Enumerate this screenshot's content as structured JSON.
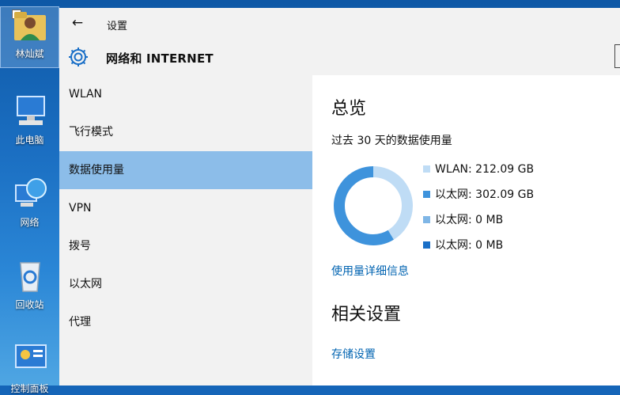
{
  "desktop": {
    "icons": [
      {
        "label": "林灿斌"
      },
      {
        "label": "此电脑"
      },
      {
        "label": "网络"
      },
      {
        "label": "回收站"
      },
      {
        "label": "控制面板"
      }
    ]
  },
  "window": {
    "title": "设置",
    "section_title": "网络和 INTERNET"
  },
  "sidebar": {
    "items": [
      {
        "label": "WLAN"
      },
      {
        "label": "飞行模式"
      },
      {
        "label": "数据使用量"
      },
      {
        "label": "VPN"
      },
      {
        "label": "拨号"
      },
      {
        "label": "以太网"
      },
      {
        "label": "代理"
      }
    ],
    "active_index": 2
  },
  "main": {
    "overview_title": "总览",
    "usage_caption": "过去 30 天的数据使用量",
    "details_link": "使用量详细信息",
    "related_title": "相关设置",
    "storage_link": "存储设置"
  },
  "chart_data": {
    "type": "pie",
    "categories": [
      "WLAN",
      "以太网",
      "以太网",
      "以太网"
    ],
    "values": [
      212.09,
      302.09,
      0,
      0
    ],
    "labels": [
      "WLAN: 212.09 GB",
      "以太网: 302.09 GB",
      "以太网: 0 MB",
      "以太网: 0 MB"
    ],
    "colors": [
      "#bfdcf5",
      "#3e93dc",
      "#7fb6e6",
      "#1a6fc7"
    ]
  }
}
